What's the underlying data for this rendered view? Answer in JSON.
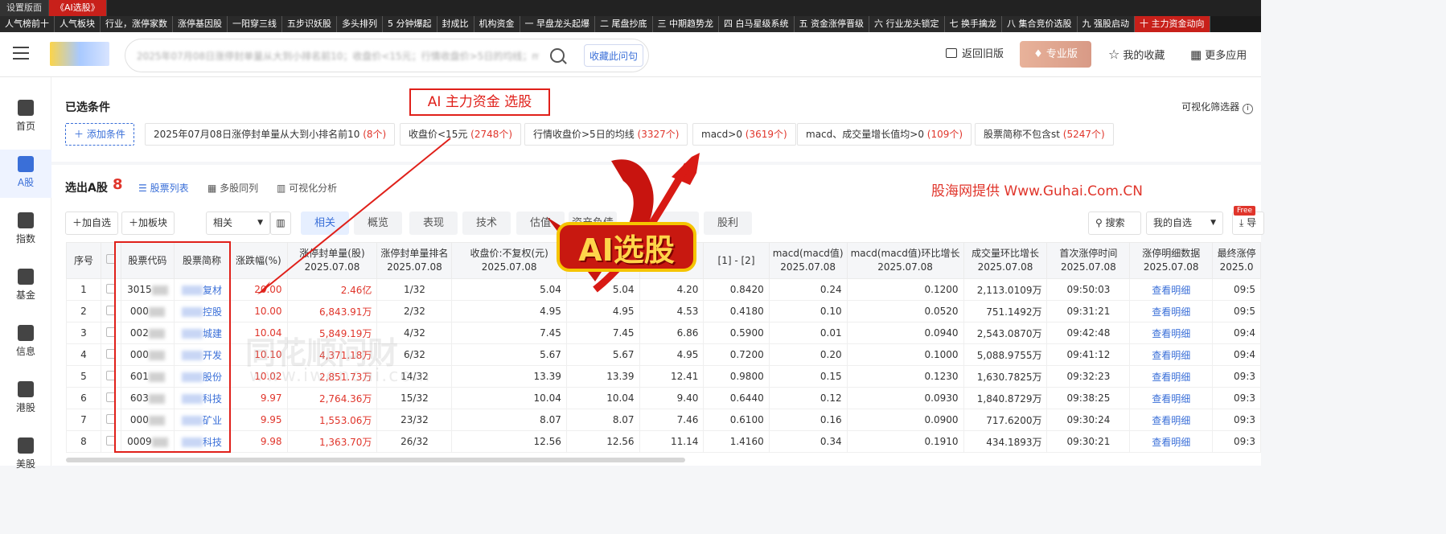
{
  "top_tabs": [
    "设置版面",
    "《AI选股》"
  ],
  "strategy_tabs": [
    "人气榜前十",
    "人气板块",
    "行业，涨停家数",
    "涨停基因股",
    "一阳穿三线",
    "五步识妖股",
    "多头排列",
    "5 分钟爆起",
    "封成比",
    "机构资金",
    "一 早盘龙头起爆",
    "二 尾盘抄底",
    "三 中期趋势龙",
    "四 白马星级系统",
    "五 资金涨停晋级",
    "六 行业龙头锁定",
    "七 换手擒龙",
    "八 集合竞价选股",
    "九 强股启动",
    "十 主力资金动向"
  ],
  "header": {
    "search_query": "2025年07月08日涨停封单量从大到小排名前10；收盘价<15元；行情收盘价>5日的均线；macd>0",
    "collect_label": "收藏此问句",
    "back_old": "返回旧版",
    "pro": "专业版",
    "favorites": "我的收藏",
    "more_apps": "更多应用"
  },
  "sidebar": [
    {
      "label": "首页",
      "icon": "home-icon"
    },
    {
      "label": "A股",
      "icon": "chart-icon"
    },
    {
      "label": "指数",
      "icon": "index-icon"
    },
    {
      "label": "基金",
      "icon": "yen-icon"
    },
    {
      "label": "信息",
      "icon": "info-icon"
    },
    {
      "label": "港股",
      "icon": "hk-icon"
    },
    {
      "label": "美股",
      "icon": "us-icon"
    }
  ],
  "conditions": {
    "title": "已选条件",
    "visual_filter": "可视化筛选器",
    "add": "添加条件",
    "chips": [
      {
        "text": "2025年07月08日涨停封单量从大到小排名前10",
        "count": "(8个)"
      },
      {
        "text": "收盘价<15元",
        "count": "(2748个)"
      },
      {
        "text": "行情收盘价>5日的均线",
        "count": "(3327个)"
      },
      {
        "text": "macd>0",
        "count": "(3619个)"
      },
      {
        "text": "macd、成交量增长值均>0",
        "count": "(109个)"
      },
      {
        "text": "股票简称不包含st",
        "count": "(5247个)"
      }
    ]
  },
  "annotation": {
    "box": "AI 主力资金 选股",
    "source": "股海网提供 Www.Guhai.Com.CN",
    "badge": "AI选股",
    "watermark": "同花顺问财",
    "watermark_url": "www.iwencai.com"
  },
  "results": {
    "title": "选出A股",
    "count": "8",
    "views": [
      "股票列表",
      "多股同列",
      "可视化分析"
    ],
    "add_self": "加自选",
    "add_block": "加板块",
    "sort": "相关",
    "filter_tabs": [
      "相关",
      "概览",
      "表现",
      "技术",
      "估值",
      "资产负债",
      "",
      "股利"
    ],
    "search_btn": "搜索",
    "my_self": "我的自选",
    "export": "导",
    "free": "Free"
  },
  "table": {
    "headers": [
      {
        "l1": "序号",
        "l2": ""
      },
      {
        "l1": "",
        "l2": ""
      },
      {
        "l1": "股票代码",
        "l2": ""
      },
      {
        "l1": "股票简称",
        "l2": ""
      },
      {
        "l1": "涨跌幅(%)",
        "l2": ""
      },
      {
        "l1": "涨停封单量(股)",
        "l2": "2025.07.08"
      },
      {
        "l1": "涨停封单量排名",
        "l2": "2025.07.08"
      },
      {
        "l1": "收盘价:不复权(元)",
        "l2": "2025.07.08"
      },
      {
        "l1": "",
        "l2": ""
      },
      {
        "l1": "",
        "l2": ""
      },
      {
        "l1": "[1] - [2]",
        "l2": ""
      },
      {
        "l1": "macd(macd值)",
        "l2": "2025.07.08"
      },
      {
        "l1": "macd(macd值)环比增长",
        "l2": "2025.07.08"
      },
      {
        "l1": "成交量环比增长",
        "l2": "2025.07.08"
      },
      {
        "l1": "首次涨停时间",
        "l2": "2025.07.08"
      },
      {
        "l1": "涨停明细数据",
        "l2": "2025.07.08"
      },
      {
        "l1": "最终涨停",
        "l2": "2025.0"
      }
    ],
    "rows": [
      {
        "no": "1",
        "code": "3015",
        "name": "复材",
        "chg": "20.00",
        "seal": "2.46亿",
        "rank": "1/32",
        "close": "5.04",
        "c2": "5.04",
        "c3": "4.20",
        "diff": "0.8420",
        "macd": "0.24",
        "macdg": "0.1200",
        "vol": "2,113.0109万",
        "first": "09:50:03",
        "detail": "查看明细",
        "last": "09:5"
      },
      {
        "no": "2",
        "code": "000",
        "name": "控股",
        "chg": "10.00",
        "seal": "6,843.91万",
        "rank": "2/32",
        "close": "4.95",
        "c2": "4.95",
        "c3": "4.53",
        "diff": "0.4180",
        "macd": "0.10",
        "macdg": "0.0520",
        "vol": "751.1492万",
        "first": "09:31:21",
        "detail": "查看明细",
        "last": "09:5"
      },
      {
        "no": "3",
        "code": "002",
        "name": "城建",
        "chg": "10.04",
        "seal": "5,849.19万",
        "rank": "4/32",
        "close": "7.45",
        "c2": "7.45",
        "c3": "6.86",
        "diff": "0.5900",
        "macd": "0.01",
        "macdg": "0.0940",
        "vol": "2,543.0870万",
        "first": "09:42:48",
        "detail": "查看明细",
        "last": "09:4"
      },
      {
        "no": "4",
        "code": "000",
        "name": "开发",
        "chg": "10.10",
        "seal": "4,371.18万",
        "rank": "6/32",
        "close": "5.67",
        "c2": "5.67",
        "c3": "4.95",
        "diff": "0.7200",
        "macd": "0.20",
        "macdg": "0.1000",
        "vol": "5,088.9755万",
        "first": "09:41:12",
        "detail": "查看明细",
        "last": "09:4"
      },
      {
        "no": "5",
        "code": "601",
        "name": "股份",
        "chg": "10.02",
        "seal": "2,851.73万",
        "rank": "14/32",
        "close": "13.39",
        "c2": "13.39",
        "c3": "12.41",
        "diff": "0.9800",
        "macd": "0.15",
        "macdg": "0.1230",
        "vol": "1,630.7825万",
        "first": "09:32:23",
        "detail": "查看明细",
        "last": "09:3"
      },
      {
        "no": "6",
        "code": "603",
        "name": "科技",
        "chg": "9.97",
        "seal": "2,764.36万",
        "rank": "15/32",
        "close": "10.04",
        "c2": "10.04",
        "c3": "9.40",
        "diff": "0.6440",
        "macd": "0.12",
        "macdg": "0.0930",
        "vol": "1,840.8729万",
        "first": "09:38:25",
        "detail": "查看明细",
        "last": "09:3"
      },
      {
        "no": "7",
        "code": "000",
        "name": "矿业",
        "chg": "9.95",
        "seal": "1,553.06万",
        "rank": "23/32",
        "close": "8.07",
        "c2": "8.07",
        "c3": "7.46",
        "diff": "0.6100",
        "macd": "0.16",
        "macdg": "0.0900",
        "vol": "717.6200万",
        "first": "09:30:24",
        "detail": "查看明细",
        "last": "09:3"
      },
      {
        "no": "8",
        "code": "0009",
        "name": "科技",
        "chg": "9.98",
        "seal": "1,363.70万",
        "rank": "26/32",
        "close": "12.56",
        "c2": "12.56",
        "c3": "11.14",
        "diff": "1.4160",
        "macd": "0.34",
        "macdg": "0.1910",
        "vol": "434.1893万",
        "first": "09:30:21",
        "detail": "查看明细",
        "last": "09:3"
      }
    ]
  }
}
